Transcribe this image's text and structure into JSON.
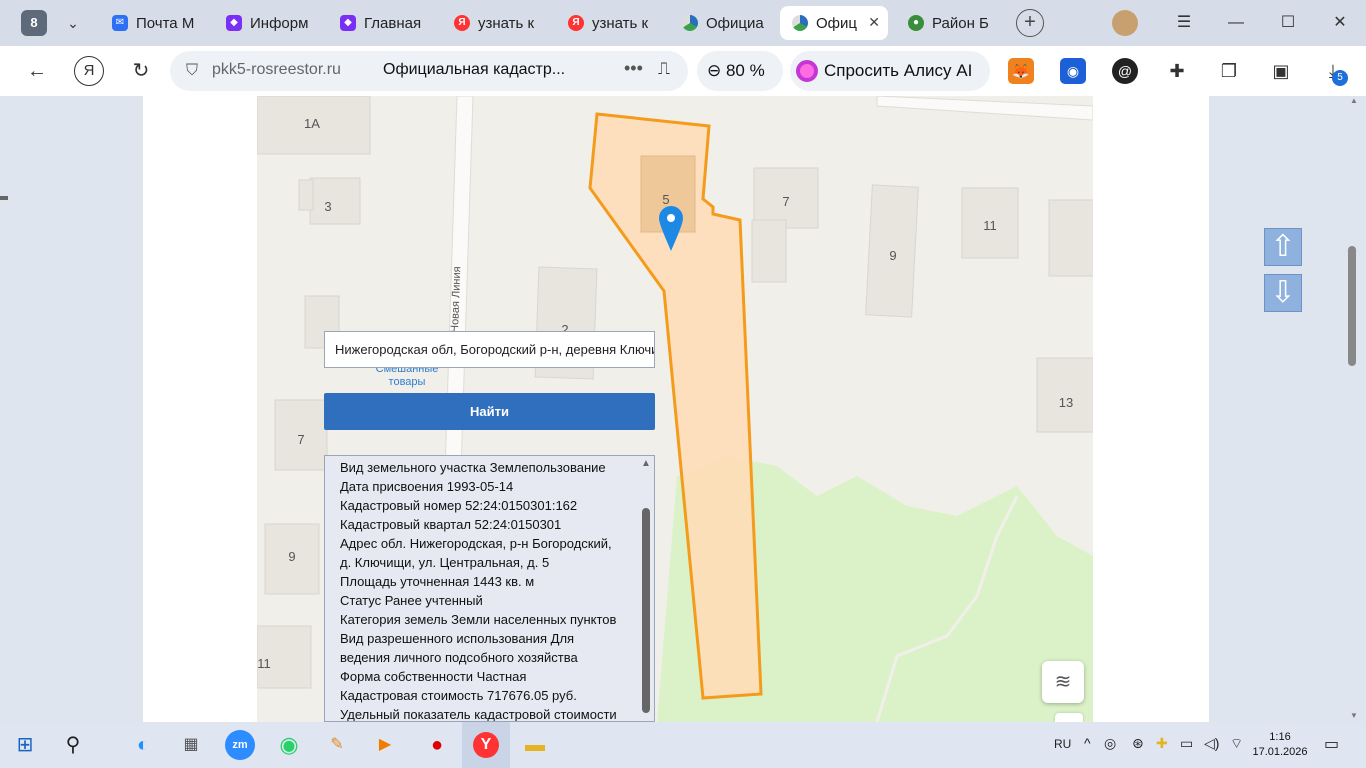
{
  "browser": {
    "tab_count": "8",
    "tabs": [
      {
        "label": "Почта М",
        "icon": "mail-icon",
        "color": "#2d6ff5"
      },
      {
        "label": "Информ",
        "icon": "sber-icon",
        "color": "#7a2ff5"
      },
      {
        "label": "Главная",
        "icon": "sber-icon",
        "color": "#7a2ff5"
      },
      {
        "label": "узнать к",
        "icon": "yandex-icon",
        "color": "#f33"
      },
      {
        "label": "узнать к",
        "icon": "yandex-icon",
        "color": "#f33"
      },
      {
        "label": "Официа",
        "icon": "rosreestr-icon",
        "color": "#2a6fbf"
      },
      {
        "label": "Офиц",
        "icon": "rosreestr-icon",
        "color": "#2a6fbf"
      },
      {
        "label": "Район Б",
        "icon": "globe-icon",
        "color": "#3a8d3a"
      }
    ],
    "close_glyph": "✕",
    "address": {
      "host": "pkk5-rosreestor.ru",
      "title": "Официальная кадастр...",
      "dots": "•••"
    },
    "zoom": "80 %",
    "alice_label": "Спросить Алису AI",
    "download_badge": "5"
  },
  "map": {
    "building_labels": [
      "1А",
      "3",
      "5",
      "7",
      "11",
      "9",
      "2",
      "7",
      "13",
      "9",
      "11"
    ],
    "street_label": "Новая Линия",
    "poi_label_line1": "Смешанные",
    "poi_label_line2": "товары"
  },
  "search": {
    "value": "Нижегородская обл, Богородский р-н, деревня Ключищи",
    "button_label": "Найти"
  },
  "info": {
    "lines": [
      "Вид земельного участка Землепользование",
      "Дата присвоения 1993-05-14",
      "Кадастровый номер 52:24:0150301:162",
      "Кадастровый квартал 52:24:0150301",
      "Адрес обл. Нижегородская, р-н Богородский,",
      "д. Ключищи, ул. Центральная, д. 5",
      "Площадь уточненная 1443 кв. м",
      "Статус Ранее учтенный",
      "Категория земель Земли населенных пунктов",
      "Вид разрешенного использования Для",
      "ведения личного подсобного хозяйства",
      "Форма собственности Частная",
      "Кадастровая стоимость 717676.05 руб.",
      "Удельный показатель кадастровой стоимости"
    ]
  },
  "colors": {
    "parcel_fill": "#ffdcb6",
    "parcel_stroke": "#f59b1c",
    "marker": "#1e88e5",
    "green_area": "#dbf2c8",
    "button": "#2f6fbd"
  },
  "taskbar": {
    "lang": "RU",
    "time": "1:16",
    "date": "17.01.2026"
  }
}
